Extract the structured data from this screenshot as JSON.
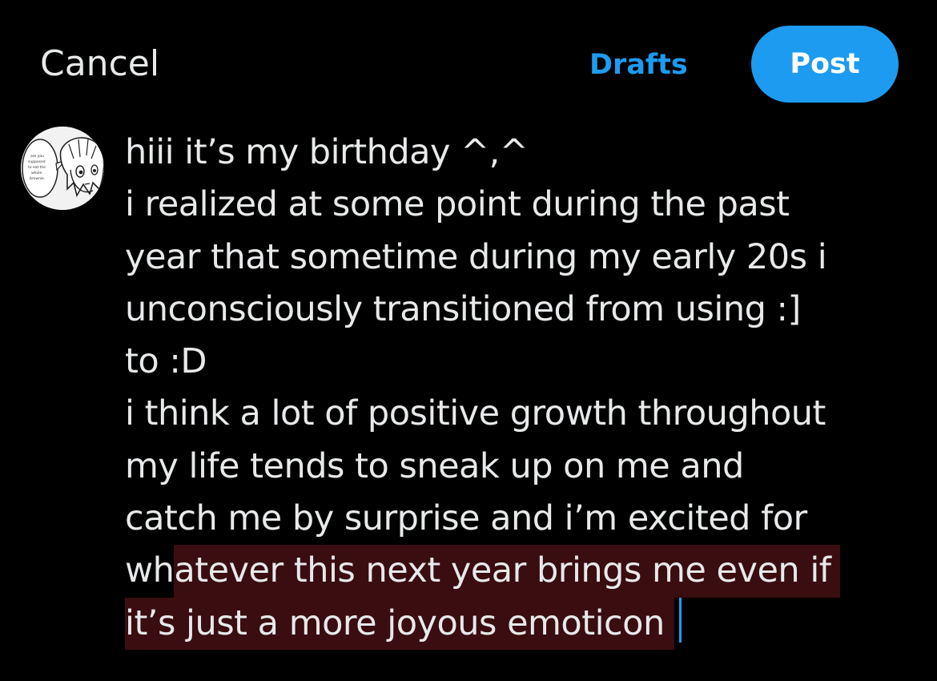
{
  "header": {
    "cancel_label": "Cancel",
    "drafts_label": "Drafts",
    "post_label": "Post"
  },
  "avatar": {
    "icon": "manga-character-avatar",
    "speech_bubble_text": "are you supposed to eat the whole brownie"
  },
  "compose": {
    "lines": [
      "hiii it’s my birthday ^,^",
      "i realized at some point during the past",
      "year that sometime during my early 20s i",
      "unconsciously transitioned from using :]",
      "to :D",
      "i think a lot of positive growth throughout",
      "my life tends to sneak up on me and",
      "catch me by surprise and i’m excited for"
    ],
    "line9_plain": "wh",
    "line9_selected": "atever this next year brings me even if",
    "line10_selected": "it’s just a more joyous emoticon"
  },
  "colors": {
    "background": "#000000",
    "text": "#e7e9ea",
    "accent": "#1d9bf0",
    "selection": "#3a0d10"
  }
}
